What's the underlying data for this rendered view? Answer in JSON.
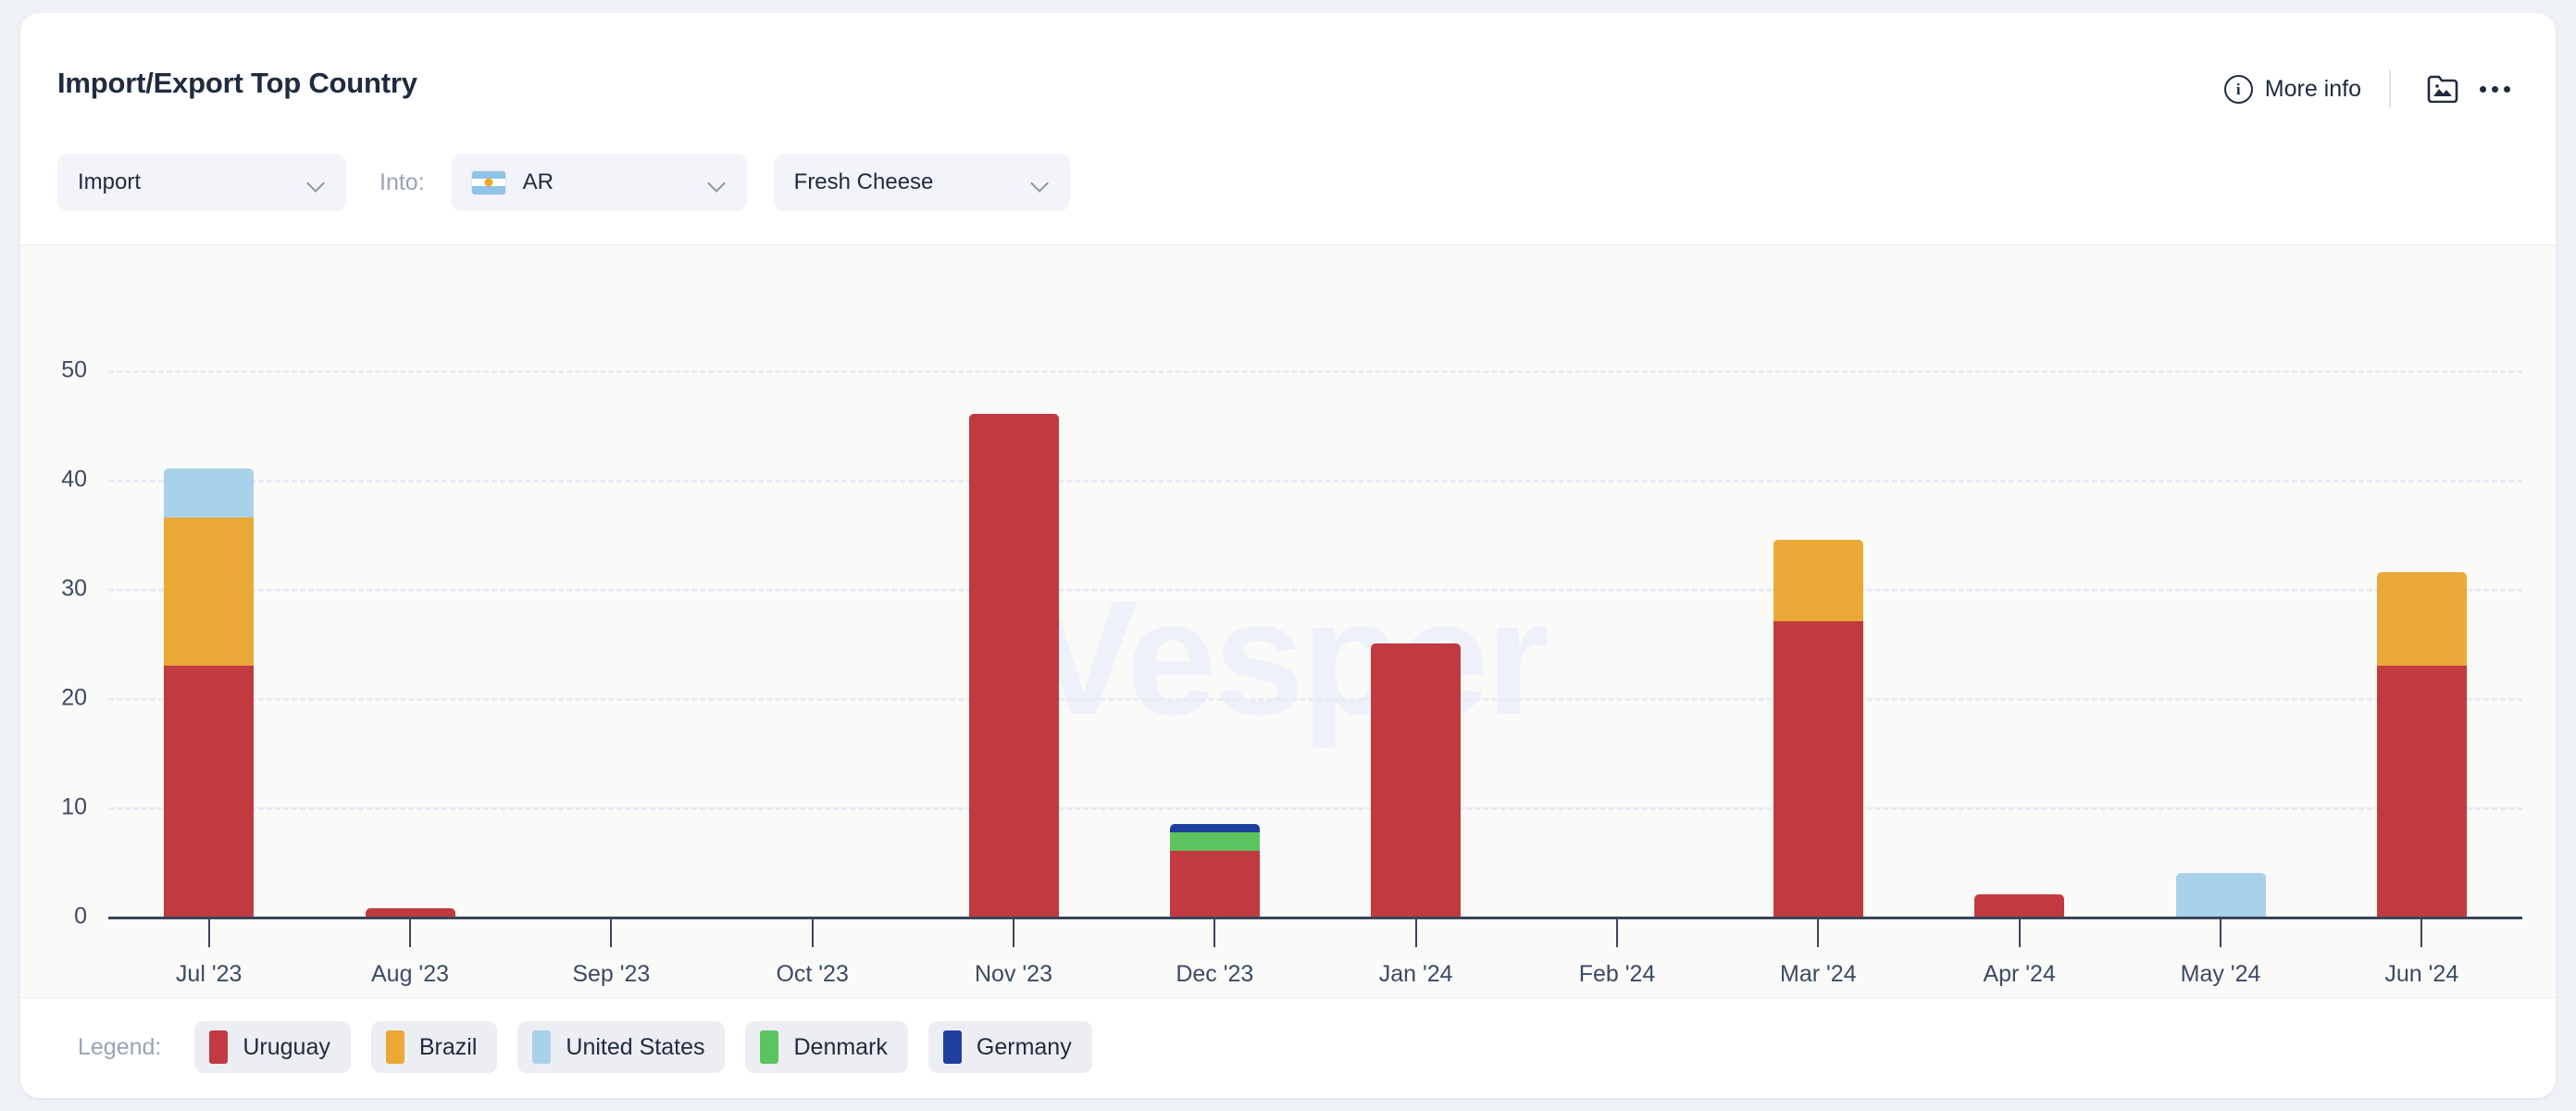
{
  "header": {
    "title": "Import/Export Top Country",
    "more_info_label": "More info",
    "info_icon": "info-circle-icon",
    "image_icon": "image-folder-icon",
    "overflow_icon": "ellipsis-icon"
  },
  "filters": {
    "trade_direction": {
      "value": "Import",
      "chevron": "chevron-down-icon"
    },
    "into_label": "Into:",
    "country": {
      "value": "AR",
      "flag": "argentina-flag-icon",
      "chevron": "chevron-down-icon"
    },
    "product": {
      "value": "Fresh Cheese",
      "chevron": "chevron-down-icon"
    }
  },
  "watermark": "Vesper",
  "legend": {
    "title": "Legend:",
    "items": [
      {
        "label": "Uruguay",
        "color": "#c13a3f"
      },
      {
        "label": "Brazil",
        "color": "#eaa937"
      },
      {
        "label": "United States",
        "color": "#a9d2ea"
      },
      {
        "label": "Denmark",
        "color": "#5cc濃"
      },
      {
        "label": "Germany",
        "color": "#1f3f9e"
      }
    ]
  },
  "chart_data": {
    "type": "bar",
    "stacked": true,
    "title": "Import/Export Top Country",
    "xlabel": "",
    "ylabel": "",
    "ylim": [
      0,
      55
    ],
    "yticks": [
      0,
      10,
      20,
      30,
      40,
      50
    ],
    "grid": true,
    "legend_position": "bottom",
    "categories": [
      "Jul '23",
      "Aug '23",
      "Sep '23",
      "Oct '23",
      "Nov '23",
      "Dec '23",
      "Jan '24",
      "Feb '24",
      "Mar '24",
      "Apr '24",
      "May '24",
      "Jun '24"
    ],
    "series": [
      {
        "name": "Uruguay",
        "color": "#c13a3f",
        "values": [
          23,
          0.8,
          0,
          0,
          46,
          6,
          25,
          0,
          27,
          2,
          0,
          23
        ]
      },
      {
        "name": "Brazil",
        "color": "#eaa937",
        "values": [
          13.5,
          0,
          0,
          0,
          0,
          0,
          0,
          0,
          7.5,
          0,
          0,
          8.5
        ]
      },
      {
        "name": "United States",
        "color": "#a9d2ea",
        "values": [
          4.5,
          0,
          0,
          0,
          0,
          0,
          0,
          0,
          0,
          0,
          4,
          0
        ]
      },
      {
        "name": "Denmark",
        "color": "#5cc45f",
        "values": [
          0,
          0,
          0,
          0,
          0,
          1.7,
          0,
          0,
          0,
          0,
          0,
          0
        ]
      },
      {
        "name": "Germany",
        "color": "#1f3f9e",
        "values": [
          0,
          0,
          0,
          0,
          0,
          0.8,
          0,
          0,
          0,
          0,
          0,
          0
        ]
      }
    ],
    "totals": [
      41,
      0.8,
      0,
      0,
      46,
      8.5,
      25,
      0,
      34.5,
      2,
      4,
      31.5
    ]
  }
}
